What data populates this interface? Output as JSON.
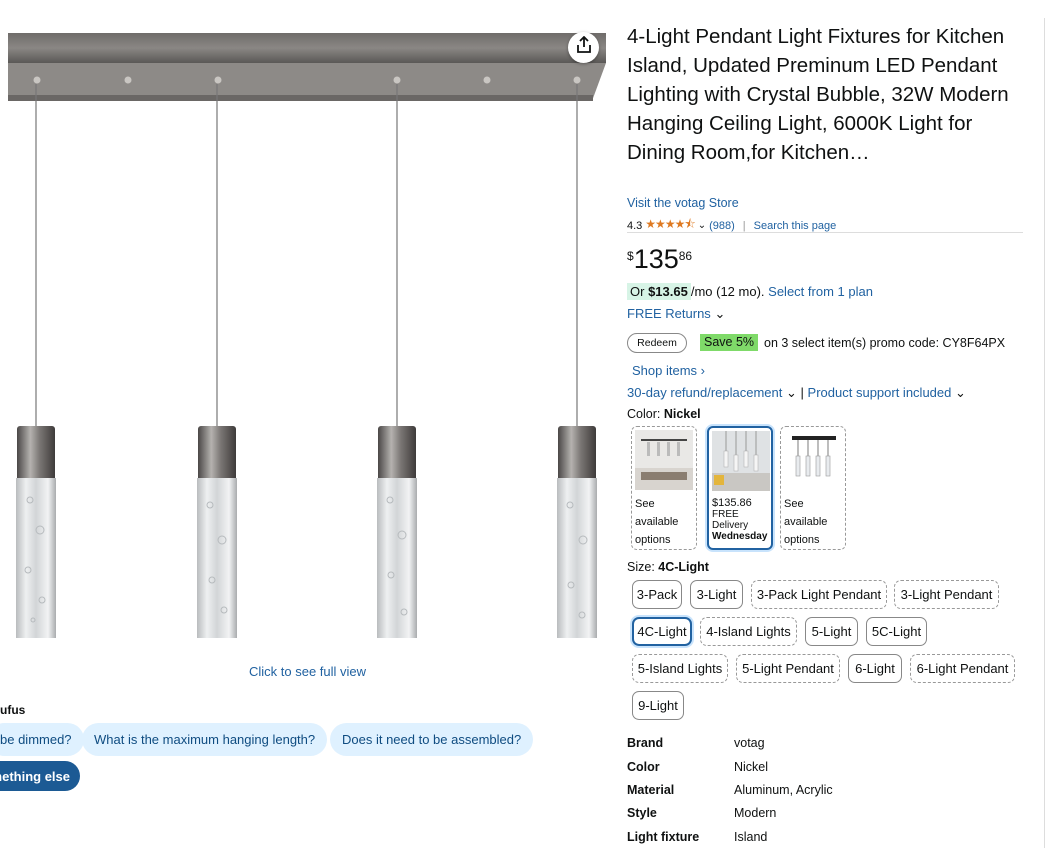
{
  "product": {
    "title": "4-Light Pendant Light Fixtures for Kitchen Island, Updated Preminum LED Pendant Lighting with Crystal Bubble, 32W Modern Hanging Ceiling Light, 6000K Light for Dining Room,for Kitchen…",
    "store_link": "Visit the votag Store",
    "rating": "4.3",
    "rating_stars": 4.3,
    "review_count": "(988)",
    "search_page": "Search this page",
    "price_symbol": "$",
    "price_whole": "135",
    "price_fraction": "86",
    "monthly_prefix": "Or",
    "monthly_amount": "$13.65",
    "monthly_suffix": "/mo (12 mo).",
    "monthly_link": "Select from 1 plan",
    "free_returns": "FREE Returns",
    "redeem": "Redeem",
    "save_badge": "Save 5%",
    "promo_text": "on 3 select item(s) promo code: CY8F64PX",
    "shop_items": "Shop items ›",
    "refund": "30-day refund/replacement",
    "separator": "|",
    "support": "Product support included"
  },
  "color": {
    "label": "Color:",
    "value": "Nickel",
    "swatches": [
      {
        "text": "See available options"
      },
      {
        "price": "$135.86",
        "delivery": "FREE Delivery",
        "day": "Wednesday"
      },
      {
        "text": "See available options"
      }
    ]
  },
  "size": {
    "label": "Size:",
    "value": "4C-Light",
    "options": [
      "3-Pack",
      "3-Light",
      "3-Pack Light Pendant",
      "3-Light Pendant",
      "4C-Light",
      "4-Island Lights",
      "5-Light",
      "5C-Light",
      "5-Island Lights",
      "5-Light Pendant",
      "6-Light",
      "6-Light Pendant",
      "9-Light"
    ]
  },
  "specs": [
    {
      "key": "Brand",
      "value": "votag"
    },
    {
      "key": "Color",
      "value": "Nickel"
    },
    {
      "key": "Material",
      "value": "Aluminum, Acrylic"
    },
    {
      "key": "Style",
      "value": "Modern"
    },
    {
      "key": "Light fixture",
      "value": "Island"
    }
  ],
  "gallery": {
    "full_view": "Click to see full view"
  },
  "rufus": {
    "label": "ufus",
    "chips": [
      "be dimmed?",
      "What is the maximum hanging length?",
      "Does it need to be assembled?"
    ],
    "else_chip": "mething else"
  },
  "colors": {
    "link": "#2162a1",
    "star": "#de7921",
    "save_green": "#7fda69",
    "selected_border": "#2162a1"
  },
  "icons": {
    "share": "share-icon",
    "chevron": "chevron-down-icon"
  }
}
